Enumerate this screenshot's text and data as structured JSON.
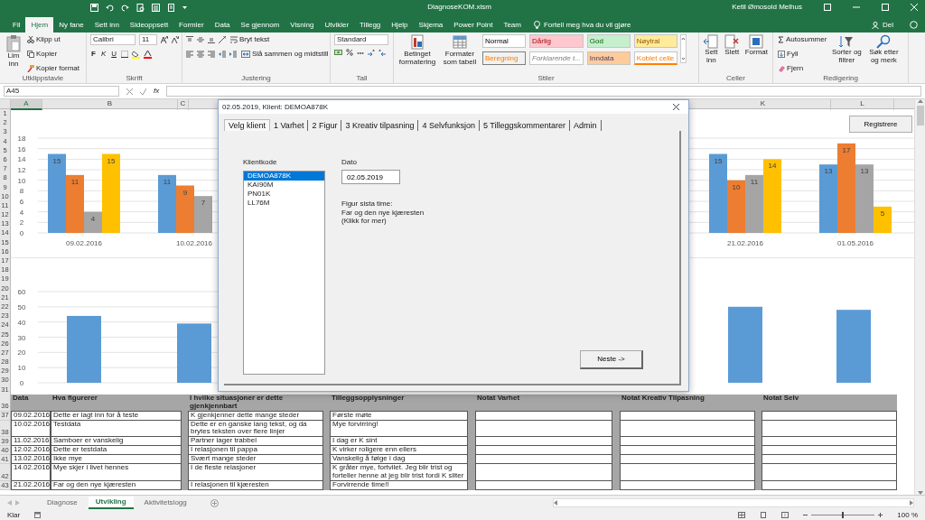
{
  "title_bar": {
    "file_name": "DiagnoseKOM.xlsm",
    "user": "Ketil Ømosold Melhus"
  },
  "ribbon_tabs": [
    {
      "label": "Fil",
      "selected": false
    },
    {
      "label": "Hjem",
      "selected": true
    },
    {
      "label": "Ny fane",
      "selected": false
    },
    {
      "label": "Sett inn",
      "selected": false
    },
    {
      "label": "Sideoppsett",
      "selected": false
    },
    {
      "label": "Formler",
      "selected": false
    },
    {
      "label": "Data",
      "selected": false
    },
    {
      "label": "Se gjennom",
      "selected": false
    },
    {
      "label": "Visning",
      "selected": false
    },
    {
      "label": "Utvikler",
      "selected": false
    },
    {
      "label": "Tillegg",
      "selected": false
    },
    {
      "label": "Hjelp",
      "selected": false
    },
    {
      "label": "Skjema",
      "selected": false
    },
    {
      "label": "Power Point",
      "selected": false
    },
    {
      "label": "Team",
      "selected": false
    }
  ],
  "tell_me": "Fortell meg hva du vil gjøre",
  "share": "Del",
  "ribbon": {
    "clipboard": {
      "label": "Utklippstavle",
      "paste": "Lim inn",
      "cut": "Klipp ut",
      "copy": "Kopier",
      "format_painter": "Kopier format"
    },
    "font": {
      "label": "Skrift",
      "font_name": "Calibri",
      "font_size": "11",
      "bold": "F",
      "italic": "K",
      "underline": "U"
    },
    "alignment": {
      "label": "Justering",
      "wrap_text": "Bryt tekst",
      "merge": "Slå sammen og midtstill"
    },
    "number": {
      "label": "Tall",
      "format": "Standard"
    },
    "styles": {
      "label": "Stiler",
      "conditional": "Betinget formatering",
      "format_table": "Formater som tabell",
      "cell_styles": [
        {
          "label": "Normal",
          "kind": "normal",
          "color": "#ffffff"
        },
        {
          "label": "Dårlig",
          "kind": "bad",
          "color": "#ffc7ce"
        },
        {
          "label": "God",
          "kind": "good",
          "color": "#c6efce"
        },
        {
          "label": "Nøytral",
          "kind": "neutral",
          "color": "#ffeb9c"
        },
        {
          "label": "Beregning",
          "kind": "calculation",
          "color": "#f2f2f2"
        },
        {
          "label": "Forklarende t...",
          "kind": "explanatory",
          "color": "#ffffff"
        },
        {
          "label": "Inndata",
          "kind": "input",
          "color": "#ffcc99"
        },
        {
          "label": "Koblet celle",
          "kind": "linked",
          "color": "#ffffff"
        }
      ]
    },
    "cells": {
      "label": "Celler",
      "insert": "Sett inn",
      "delete": "Slett",
      "format": "Format"
    },
    "editing": {
      "label": "Redigering",
      "autosum": "Autosummer",
      "fill": "Fyll",
      "clear": "Fjern",
      "sort": "Sorter og filtrer",
      "find": "Søk etter og merk"
    }
  },
  "formula_bar": {
    "name_box": "A45",
    "fx": "fx"
  },
  "column_headers": [
    {
      "label": "A",
      "selected": true
    },
    {
      "label": "B",
      "selected": false
    },
    {
      "label": "C",
      "selected": false
    },
    {
      "label": "K",
      "selected": false
    },
    {
      "label": "L",
      "selected": false
    }
  ],
  "row_numbers": [
    "1",
    "2",
    "3",
    "4",
    "5",
    "6",
    "7",
    "8",
    "9",
    "10",
    "11",
    "12",
    "13",
    "14",
    "15",
    "16",
    "17",
    "18",
    "19",
    "20",
    "21",
    "22",
    "23",
    "24",
    "25",
    "26",
    "27",
    "28",
    "29",
    "30",
    "31"
  ],
  "charts": [
    {
      "chart_data": {
        "type": "bar",
        "categories": [
          "09.02.2016",
          "10.02.2016"
        ],
        "series": [
          {
            "color": "#5b9bd5",
            "values": [
              15,
              11
            ]
          },
          {
            "color": "#ed7d31",
            "values": [
              11,
              9
            ]
          },
          {
            "color": "#a5a5a5",
            "values": [
              4,
              7
            ]
          },
          {
            "color": "#ffc000",
            "values": [
              15,
              null
            ]
          }
        ],
        "ylim": [
          0,
          18
        ],
        "yticks": [
          0,
          2,
          4,
          6,
          8,
          10,
          12,
          14,
          16,
          18
        ],
        "grid": true,
        "data_labels": true
      }
    },
    {
      "chart_data": {
        "type": "bar",
        "categories": [
          "21.02.2016",
          "01.05.2016"
        ],
        "series": [
          {
            "color": "#5b9bd5",
            "values": [
              15,
              13
            ]
          },
          {
            "color": "#ed7d31",
            "values": [
              10,
              17
            ]
          },
          {
            "color": "#a5a5a5",
            "values": [
              11,
              13
            ]
          },
          {
            "color": "#ffc000",
            "values": [
              14,
              5
            ]
          }
        ],
        "ylim": [
          0,
          18
        ],
        "grid": true,
        "data_labels": true
      }
    },
    {
      "chart_data": {
        "type": "bar",
        "series": [
          {
            "color": "#5b9bd5",
            "values": [
              44,
              39
            ]
          }
        ],
        "ylim": [
          0,
          60
        ],
        "yticks": [
          0,
          10,
          20,
          30,
          40,
          50,
          60
        ],
        "grid": true
      }
    }
  ],
  "register_button": "Registrere",
  "table": {
    "header_row_number": "36",
    "columns": [
      "Data",
      "Hva figurerer",
      "I hvilke situasjoner er dette gjenkjennbart",
      "Tilleggsopplysninger",
      "Notat Varhet",
      "Notat Kreativ Tilpasning",
      "Notat Selv"
    ],
    "rows": [
      {
        "row_number": "37",
        "cells": [
          "09.02.2016",
          "Dette er lagt inn for å teste",
          "K gjenkjenner dette mange steder",
          "Første møte"
        ]
      },
      {
        "row_number": "38",
        "cells": [
          "10.02.2016",
          "Testdata",
          "Dette er en ganske lang tekst, og da brytes teksten over flere linjer",
          "Mye forvirring!"
        ]
      },
      {
        "row_number": "39",
        "cells": [
          "11.02.2016",
          "Samboer er vanskelig",
          "Partner lager trabbel",
          "I dag er K sint"
        ]
      },
      {
        "row_number": "40",
        "cells": [
          "12.02.2016",
          "Dette er testdata",
          "I relasjonen til pappa",
          "K virker roligere enn ellers"
        ]
      },
      {
        "row_number": "41",
        "cells": [
          "13.02.2016",
          "Ikke mye",
          "Svært mange steder",
          "Vanskelig å følge i dag"
        ]
      },
      {
        "row_number": "42",
        "cells": [
          "14.02.2016",
          "Mye skjer i livet hennes",
          "I de fleste relasjoner",
          "K gråter mye, fortvilet. Jeg blir trist og forteller henne at jeg blir trist fordi K sliter"
        ]
      },
      {
        "row_number": "43",
        "cells": [
          "21.02.2016",
          "Far og den nye kjæresten",
          "I relasjonen til kjæresten",
          "Forvirrende time!!"
        ]
      }
    ]
  },
  "dialog": {
    "title": "02.05.2019, Klient: DEMOA878K",
    "tabs": [
      {
        "label": "Velg klient",
        "selected": true
      },
      {
        "label": "1 Varhet",
        "selected": false
      },
      {
        "label": "2 Figur",
        "selected": false
      },
      {
        "label": "3 Kreativ tilpasning",
        "selected": false
      },
      {
        "label": "4 Selvfunksjon",
        "selected": false
      },
      {
        "label": "5 Tilleggskommentarer",
        "selected": false
      },
      {
        "label": "Admin",
        "selected": false
      }
    ],
    "client_label": "Klientkode",
    "clients": [
      {
        "label": "DEMOA878K",
        "selected": true
      },
      {
        "label": "KAI90M",
        "selected": false
      },
      {
        "label": "PN01K",
        "selected": false
      },
      {
        "label": "LL76M",
        "selected": false
      }
    ],
    "date_label": "Dato",
    "date": "02.05.2019",
    "info_lines": [
      "Figur sista time:",
      "Far og den nye kjæresten",
      "(Klikk for mer)"
    ],
    "next_button": "Neste ->"
  },
  "sheet_tabs": [
    {
      "label": "Diagnose",
      "selected": false
    },
    {
      "label": "Utvikling",
      "selected": true
    },
    {
      "label": "Aktivitetslogg",
      "selected": false
    }
  ],
  "status_bar": {
    "status": "Klar",
    "zoom": "100 %",
    "zoom_slider": {
      "level": 0.5
    }
  }
}
